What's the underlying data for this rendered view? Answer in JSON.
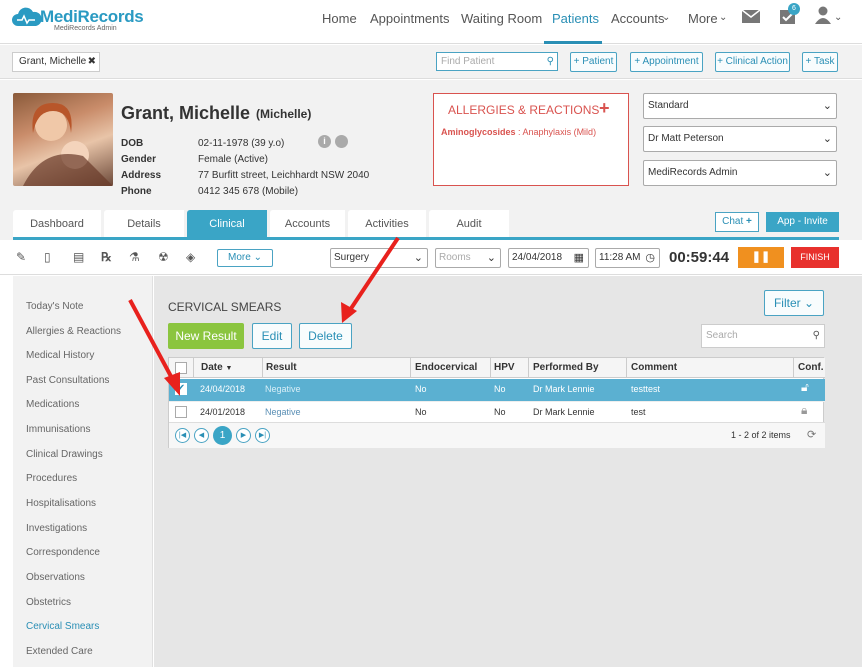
{
  "app": {
    "name": "MediRecords",
    "sub": "MediRecords Admin"
  },
  "nav": {
    "items": [
      "Home",
      "Appointments",
      "Waiting Room",
      "Patients",
      "Accounts",
      "More"
    ],
    "active": "Patients",
    "badge": "6"
  },
  "subbar": {
    "patient_tab": "Grant, Michelle",
    "find_placeholder": "Find Patient",
    "actions": [
      "+ Patient",
      "+ Appointment",
      "+ Clinical Action",
      "+ Task"
    ]
  },
  "patient": {
    "name": "Grant, Michelle",
    "nickname": "(Michelle)",
    "fields": [
      {
        "label": "DOB",
        "value": "02-11-1978 (39 y.o)"
      },
      {
        "label": "Gender",
        "value": "Female (Active)"
      },
      {
        "label": "Address",
        "value": "77 Burfitt street, Leichhardt NSW 2040"
      },
      {
        "label": "Phone",
        "value": "0412 345 678 (Mobile)"
      }
    ]
  },
  "allergies": {
    "title": "ALLERGIES & REACTIONS",
    "item_name": "Aminoglycosides",
    "item_detail": " : Anaphylaxis (Mild)"
  },
  "selects": [
    "Standard",
    "Dr Matt Peterson",
    "MediRecords Admin"
  ],
  "tabs": [
    "Dashboard",
    "Details",
    "Clinical",
    "Accounts",
    "Activities",
    "Audit"
  ],
  "active_tab": "Clinical",
  "chat_label": "Chat",
  "app_invite_label": "App - Invite",
  "toolbar": {
    "more": "More",
    "location": "Surgery",
    "rooms": "Rooms",
    "date": "24/04/2018",
    "time": "11:28 AM",
    "timer": "00:59:44",
    "pause": "❚❚",
    "finish": "FINISH"
  },
  "sidebar": {
    "items": [
      "Today's Note",
      "Allergies & Reactions",
      "Medical History",
      "Past Consultations",
      "Medications",
      "Immunisations",
      "Clinical Drawings",
      "Procedures",
      "Hospitalisations",
      "Investigations",
      "Correspondence",
      "Observations",
      "Obstetrics",
      "Cervical Smears",
      "Extended Care"
    ],
    "active": "Cervical Smears"
  },
  "main": {
    "title": "CERVICAL SMEARS",
    "filter": "Filter",
    "new_result": "New Result",
    "edit": "Edit",
    "delete": "Delete",
    "search_placeholder": "Search"
  },
  "grid": {
    "columns": [
      "Date",
      "Result",
      "Endocervical",
      "HPV",
      "Performed By",
      "Comment",
      "Conf."
    ],
    "rows": [
      {
        "date": "24/04/2018",
        "result": "Negative",
        "endo": "No",
        "hpv": "No",
        "by": "Dr Mark Lennie",
        "comment": "testtest"
      },
      {
        "date": "24/01/2018",
        "result": "Negative",
        "endo": "No",
        "hpv": "No",
        "by": "Dr Mark Lennie",
        "comment": "test"
      }
    ],
    "page": "1",
    "info": "1 - 2 of 2 items"
  },
  "colors": {
    "accent": "#3aa5c6",
    "green": "#8bc53f",
    "orange": "#f0901f",
    "red": "#e8312d",
    "allergy": "#d9534f"
  }
}
